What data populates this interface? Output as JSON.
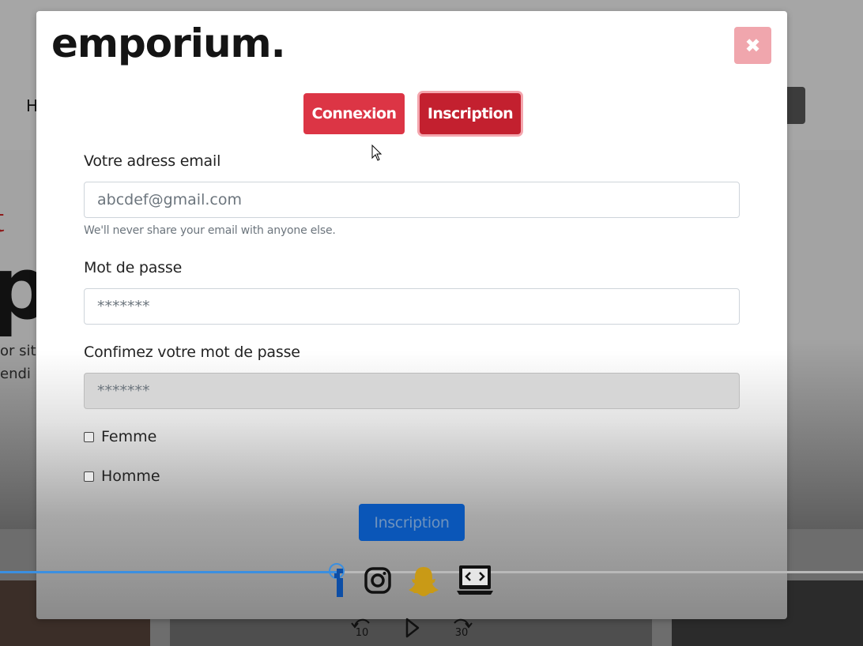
{
  "background": {
    "nav_letter": "H",
    "hero_accent": "t",
    "hero_big": "p",
    "hero_line1": "or sit",
    "hero_line2": "endi"
  },
  "modal": {
    "brand": "emporium.",
    "close_symbol": "✖",
    "tabs": {
      "login": "Connexion",
      "signup": "Inscription"
    },
    "email": {
      "label": "Votre adress email",
      "placeholder": "abcdef@gmail.com",
      "help": "We'll never share your email with anyone else."
    },
    "password": {
      "label": "Mot de passe",
      "placeholder": "*******"
    },
    "confirm": {
      "label": "Confimez votre mot de passe",
      "placeholder": "*******"
    },
    "gender_options": [
      "Femme",
      "Homme"
    ],
    "submit_label": "Inscription"
  },
  "player": {
    "progress_fraction": 0.39,
    "rewind_seconds": "10",
    "forward_seconds": "30"
  },
  "colors": {
    "danger": "#dc3545",
    "danger_active": "#c3202f",
    "primary": "#0a56b8",
    "progress": "#3b8fe0"
  },
  "icons": [
    "facebook-icon",
    "instagram-icon",
    "snapchat-icon",
    "laptop-code-icon",
    "rewind-icon",
    "play-icon",
    "forward-icon"
  ]
}
